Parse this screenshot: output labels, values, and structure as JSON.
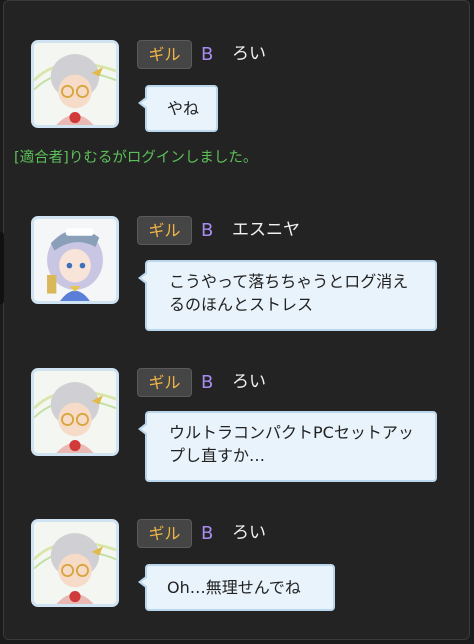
{
  "system_message": "[適合者]りむるがログインしました。",
  "colors": {
    "guild_tag": "#f0b544",
    "rank": "#a88cf0",
    "system": "#5cc05a",
    "bubble_bg": "#e8f3fb",
    "bubble_border": "#b9d6ec"
  },
  "messages": [
    {
      "guild": "ギル",
      "rank": "B",
      "sender": "ろい",
      "text": "やね",
      "avatar": "roi-avatar"
    },
    {
      "guild": "ギル",
      "rank": "B",
      "sender": "エスニヤ",
      "text": "こうやって落ちちゃうとログ消えるのほんとストレス",
      "avatar": "esniya-avatar"
    },
    {
      "guild": "ギル",
      "rank": "B",
      "sender": "ろい",
      "text": "ウルトラコンパクトPCセットアップし直すか…",
      "avatar": "roi-avatar"
    },
    {
      "guild": "ギル",
      "rank": "B",
      "sender": "ろい",
      "text": "Oh…無理せんでね",
      "avatar": "roi-avatar"
    }
  ]
}
